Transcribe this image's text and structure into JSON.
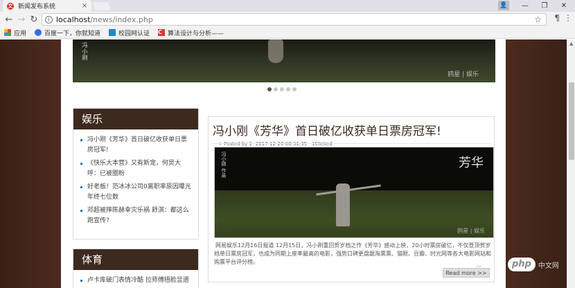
{
  "browser": {
    "tab_title": "新闻发布系统",
    "tab_close": "×",
    "url_host": "localhost",
    "url_path": "/news/index.php",
    "bookmarks": [
      {
        "label": "应用",
        "icon": "apps-icon"
      },
      {
        "label": "百度一下，你就知道",
        "icon": "paw-icon"
      },
      {
        "label": "校园网认证",
        "icon": "school-icon"
      },
      {
        "label": "算法设计与分析——",
        "icon": "csdn-icon"
      }
    ]
  },
  "banner": {
    "vertical_text": "冯小刚",
    "brand": "鸥星 | 娱乐"
  },
  "sections": [
    {
      "heading": "娱乐",
      "items": [
        "冯小刚《芳华》首日破亿收获单日票房冠军!",
        "《快乐大本营》又有新宠，何炅大呼：已被圈粉",
        "好老板！范冰冰公司0离职率原因曝光年终七位数",
        "邓超被摔陈赫幸灾乐祸 舒淇：都这么跑宣传?"
      ]
    },
    {
      "heading": "体育",
      "items": [
        "卢卡库破门表情冷酷 拉师傅捂脸显遗"
      ]
    }
  ],
  "article": {
    "title": "冯小刚《芳华》首日破亿收获单日票房冠军!",
    "meta": "+ Posted by 1 -2017-12-20 08:31:35 - 1Clicked",
    "photo_logo": "芳华",
    "photo_vertical": "冯小刚 作品",
    "photo_brand": "鸥星 | 娱乐",
    "body": "网易娱乐12月16日报道 12月15日，冯小刚重回贺岁档之作《芳华》感动上映，20小时票房破亿，不仅登顶贺岁档单日票房冠军，也成为同期上座率最高的电影，强势口碑更盘踞淘票票、猫眼、豆瓣、时光网等各大电影网站和购票平台评分榜。",
    "ellipsis": "...",
    "read_more": "Read more >>"
  },
  "watermark": {
    "logo": "php",
    "text": "中文网"
  }
}
